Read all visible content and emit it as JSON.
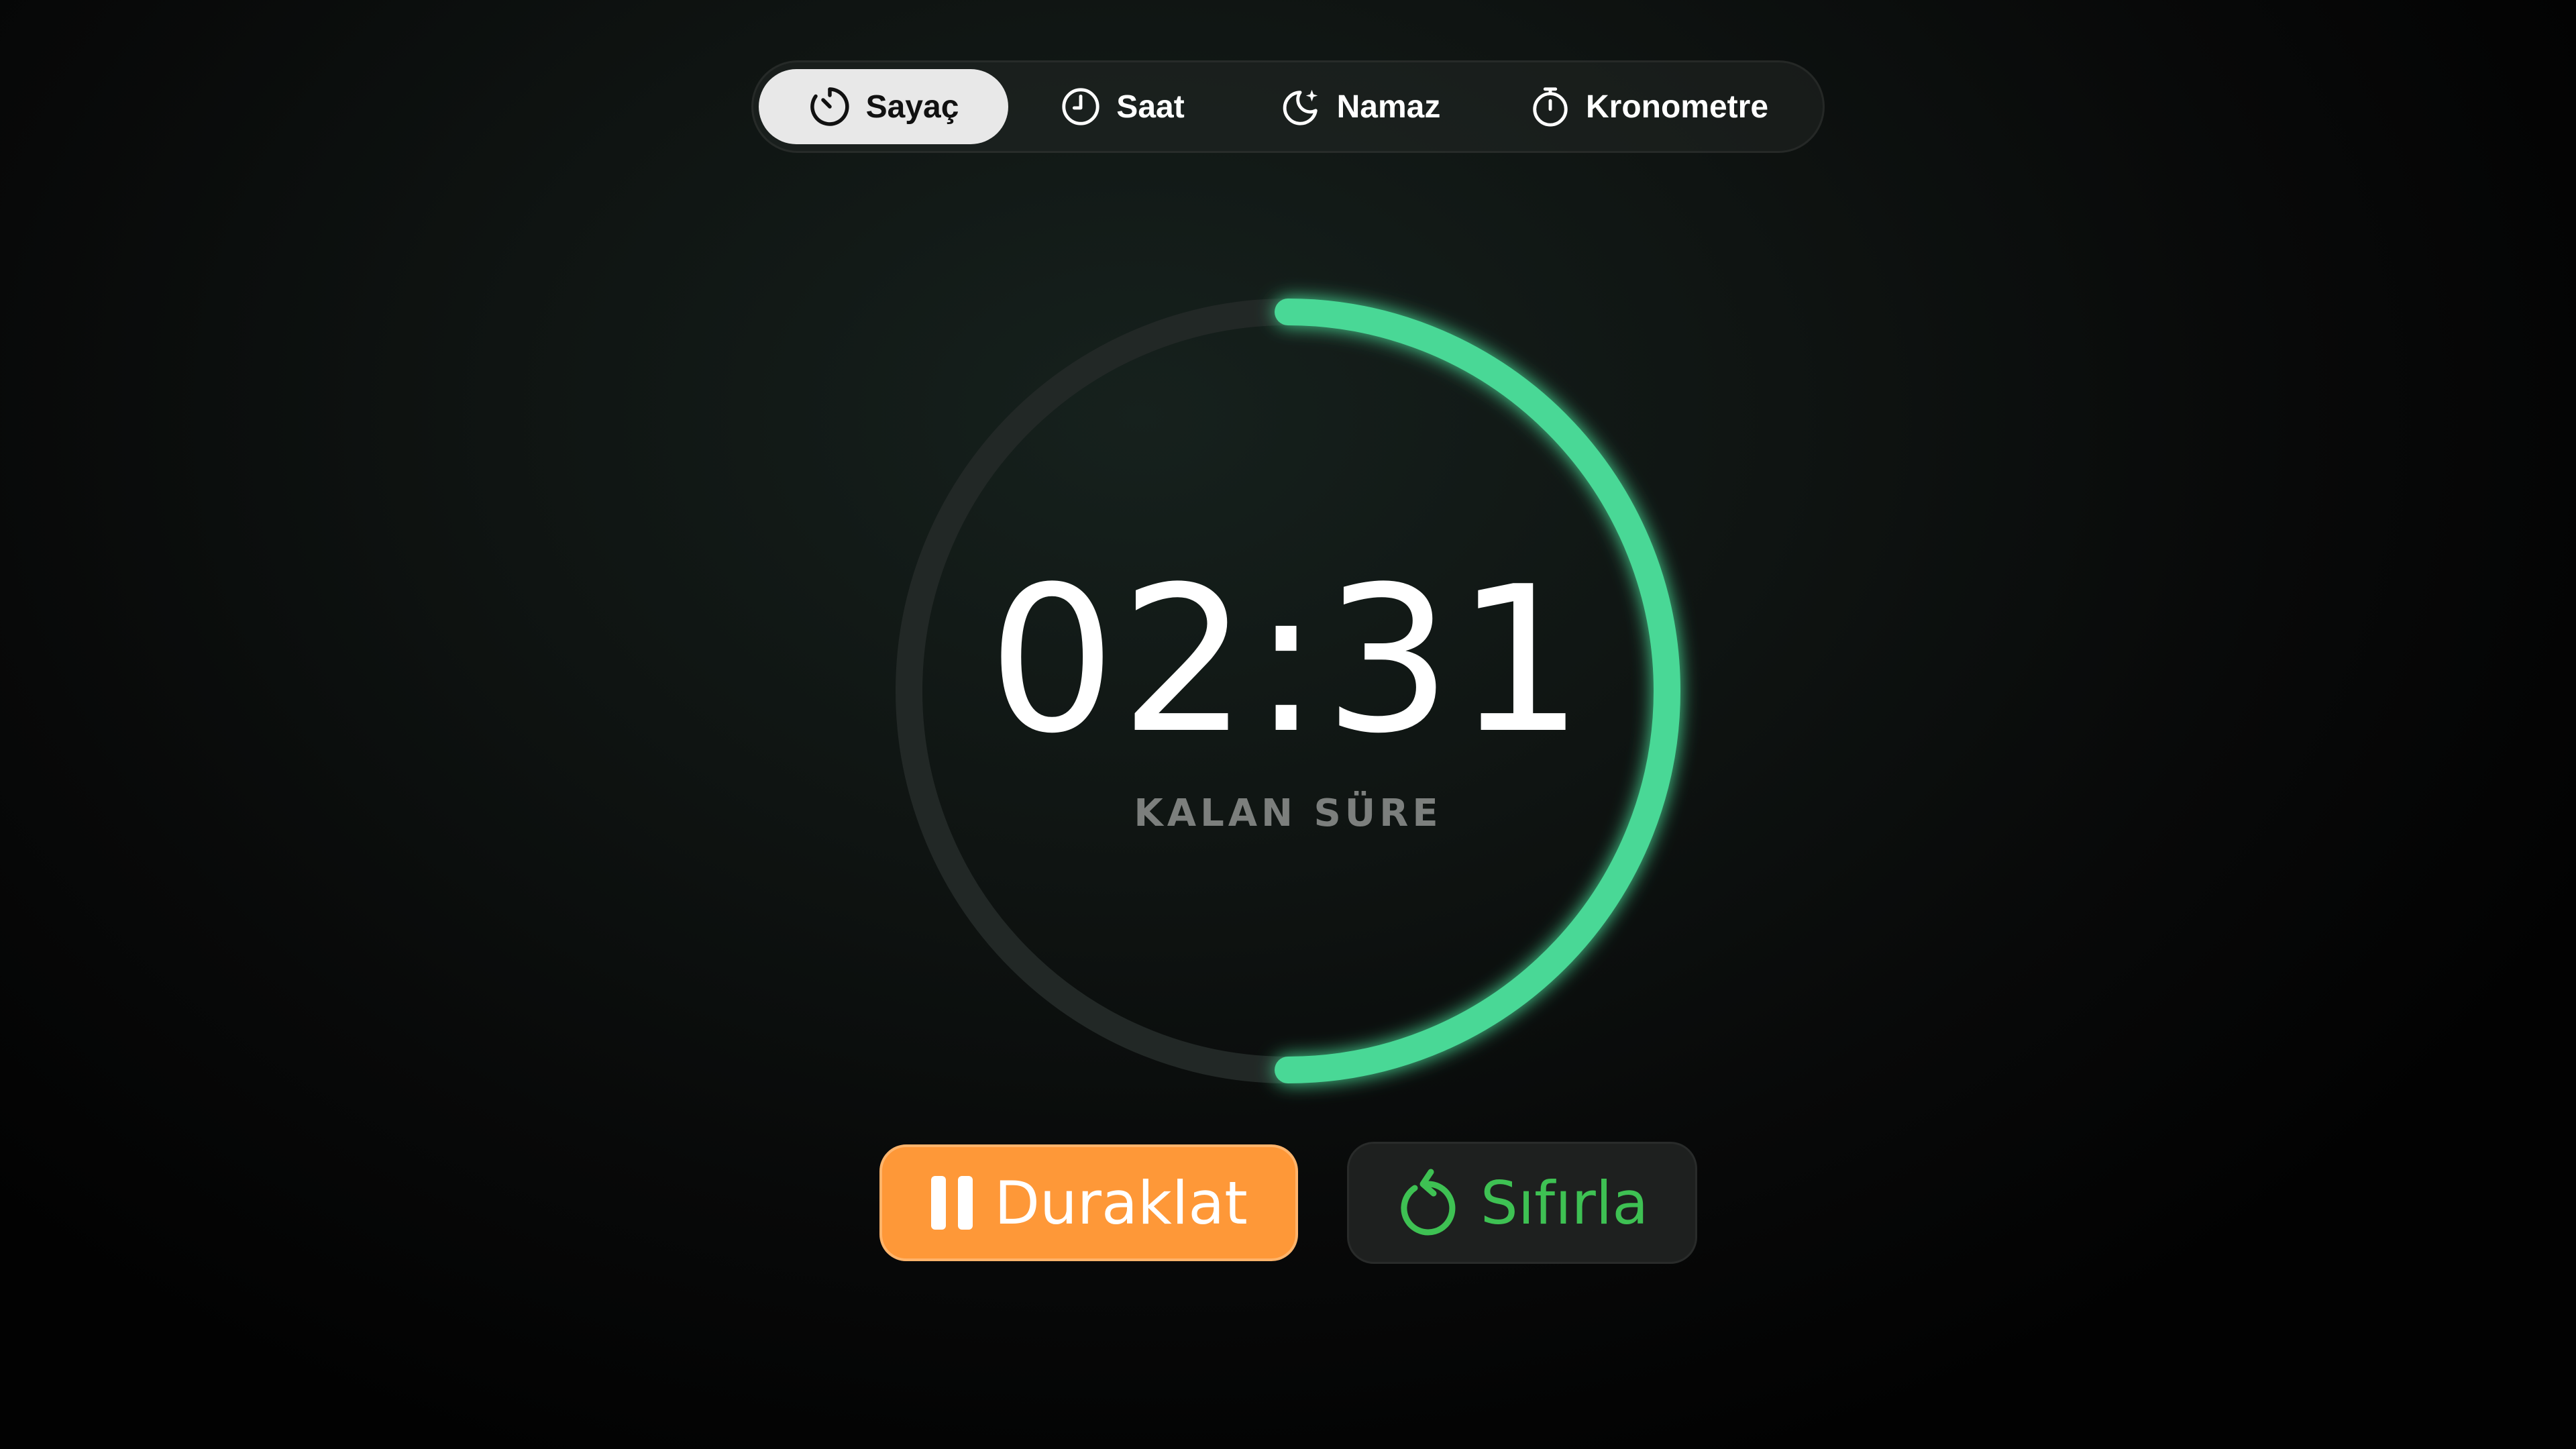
{
  "tabs": [
    {
      "label": "Sayaç",
      "icon": "timer-icon",
      "active": true
    },
    {
      "label": "Saat",
      "icon": "clock-icon",
      "active": false
    },
    {
      "label": "Namaz",
      "icon": "moon-star-icon",
      "active": false
    },
    {
      "label": "Kronometre",
      "icon": "stopwatch-icon",
      "active": false
    }
  ],
  "timer": {
    "time": "02:31",
    "label": "KALAN SÜRE",
    "progress_fraction": 0.5
  },
  "buttons": {
    "pause_label": "Duraklat",
    "pause_icon": "pause-icon",
    "reset_label": "Sıfırla",
    "reset_icon": "reset-icon"
  },
  "colors": {
    "progress": "#4ad896",
    "track": "#222826",
    "pause_button": "#fe9838",
    "reset_text": "#3ec153",
    "active_tab": "#e8e8e8"
  }
}
